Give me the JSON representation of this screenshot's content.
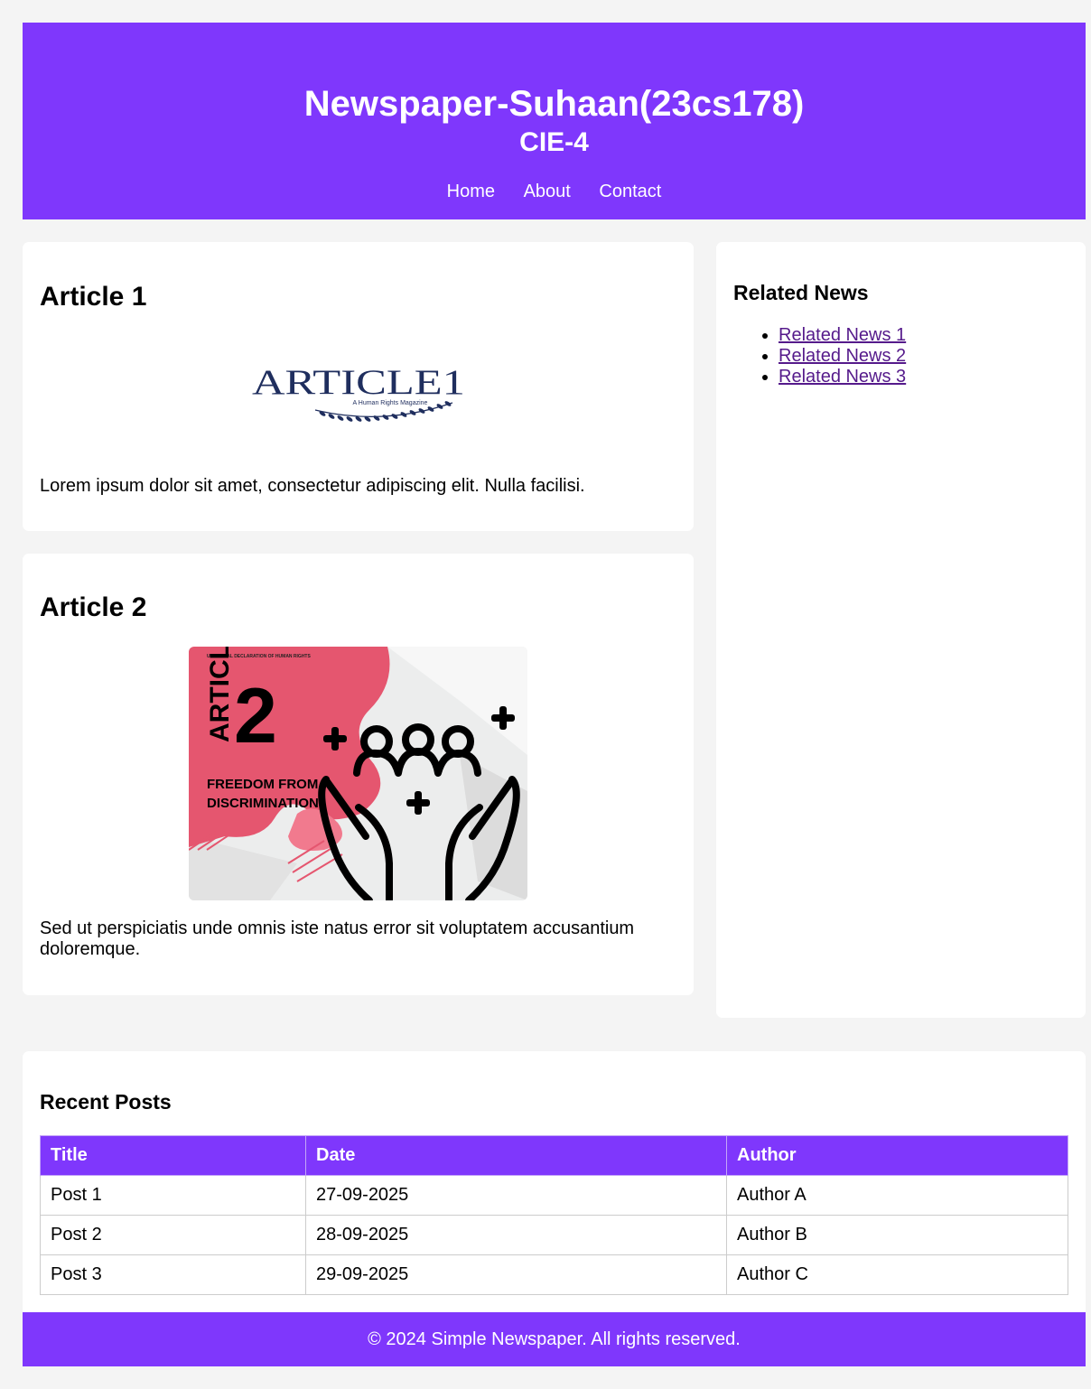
{
  "header": {
    "title": "Newspaper-Suhaan(23cs178)",
    "subtitle": "CIE-4",
    "nav": [
      "Home",
      "About",
      "Contact"
    ]
  },
  "articles": [
    {
      "title": "Article 1",
      "image": {
        "wordmark": "ARTICLE1",
        "tagline": "A Human Rights Magazine"
      },
      "text": "Lorem ipsum dolor sit amet, consectetur adipiscing elit. Nulla facilisi."
    },
    {
      "title": "Article 2",
      "image": {
        "header": "UNIVERSAL DECLARATION OF HUMAN RIGHTS",
        "word": "ARTICLE",
        "number": "2",
        "caption_line1": "FREEDOM FROM",
        "caption_line2": "DISCRIMINATION"
      },
      "text": "Sed ut perspiciatis unde omnis iste natus error sit voluptatem accusantium doloremque."
    }
  ],
  "sidebar": {
    "title": "Related News",
    "links": [
      "Related News 1",
      "Related News 2",
      "Related News 3"
    ]
  },
  "recent_posts": {
    "title": "Recent Posts",
    "columns": [
      "Title",
      "Date",
      "Author"
    ],
    "rows": [
      [
        "Post 1",
        "27-09-2025",
        "Author A"
      ],
      [
        "Post 2",
        "28-09-2025",
        "Author B"
      ],
      [
        "Post 3",
        "29-09-2025",
        "Author C"
      ]
    ]
  },
  "footer": {
    "text": "© 2024 Simple Newspaper. All rights reserved."
  },
  "colors": {
    "accent": "#7f37fc",
    "link_visited": "#551a8b",
    "article1_logo": "#1f2e5e",
    "article2_pink": "#e5566f"
  }
}
